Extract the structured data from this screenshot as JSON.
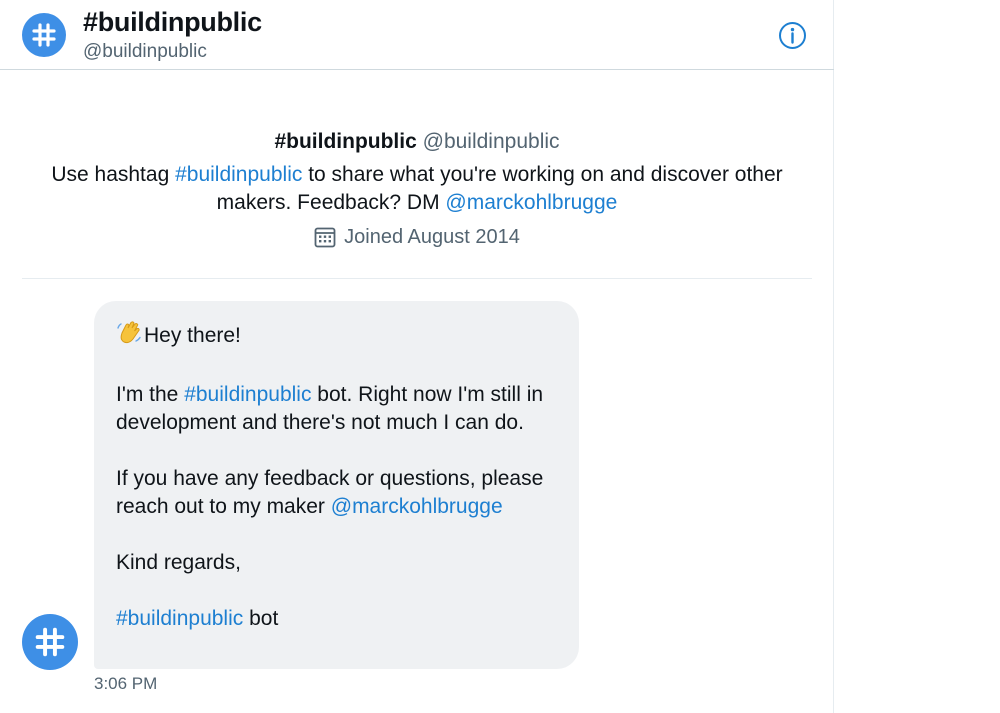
{
  "header": {
    "name": "#buildinpublic",
    "handle": "@buildinpublic",
    "info_icon": "info-circle-icon"
  },
  "profile": {
    "name": "#buildinpublic",
    "handle": "@buildinpublic",
    "bio_prefix": "Use hashtag ",
    "bio_hashtag": "#buildinpublic",
    "bio_middle": " to share what you're working on and discover other makers. Feedback? DM ",
    "bio_mention": "@marckohlbrugge",
    "joined": "Joined August 2014",
    "joined_icon": "calendar-icon"
  },
  "message": {
    "greeting": "Hey there!",
    "greeting_emoji": "waving-hand-emoji",
    "p1_prefix": "I'm the ",
    "p1_hashtag": "#buildinpublic",
    "p1_suffix": " bot. Right now I'm still in development and there's not much I can do.",
    "p2_prefix": "If you have any feedback or questions, please reach out to my maker ",
    "p2_mention": "@marckohlbrugge",
    "p3": "Kind regards,",
    "sign_hashtag": "#buildinpublic",
    "sign_suffix": " bot",
    "timestamp": "3:06 PM"
  },
  "colors": {
    "accent": "#1d7fd1",
    "avatar": "#3e8fe6",
    "bubble": "#eff1f3",
    "muted": "#536471"
  }
}
